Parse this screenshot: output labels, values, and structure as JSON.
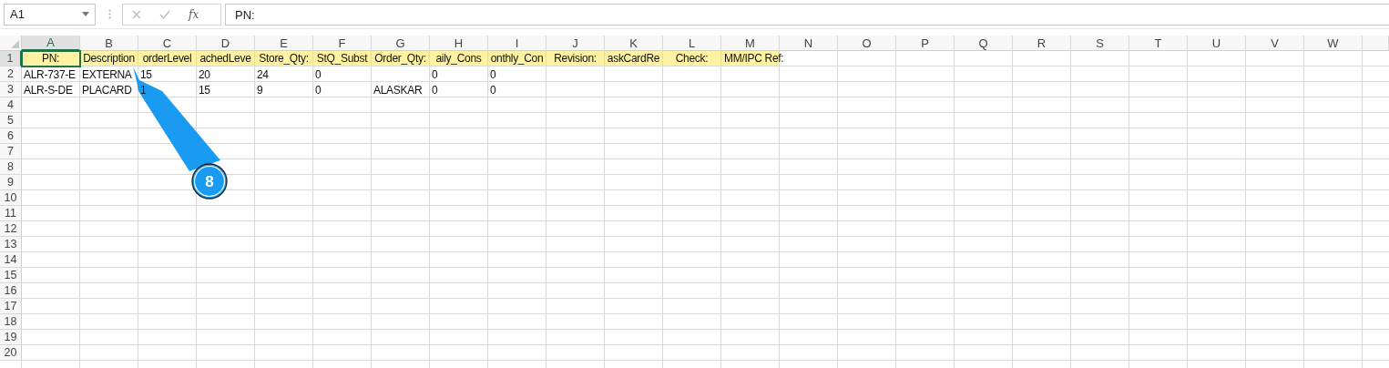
{
  "name_box": {
    "value": "A1"
  },
  "formula_bar": {
    "function_label": "fx",
    "value": "PN:"
  },
  "columns": [
    {
      "label": "A",
      "selected": true
    },
    {
      "label": "B",
      "selected": false
    },
    {
      "label": "C",
      "selected": false
    },
    {
      "label": "D",
      "selected": false
    },
    {
      "label": "E",
      "selected": false
    },
    {
      "label": "F",
      "selected": false
    },
    {
      "label": "G",
      "selected": false
    },
    {
      "label": "H",
      "selected": false
    },
    {
      "label": "I",
      "selected": false
    },
    {
      "label": "J",
      "selected": false
    },
    {
      "label": "K",
      "selected": false
    },
    {
      "label": "L",
      "selected": false
    },
    {
      "label": "M",
      "selected": false
    },
    {
      "label": "N",
      "selected": false
    },
    {
      "label": "O",
      "selected": false
    },
    {
      "label": "P",
      "selected": false
    },
    {
      "label": "Q",
      "selected": false
    },
    {
      "label": "R",
      "selected": false
    },
    {
      "label": "S",
      "selected": false
    },
    {
      "label": "T",
      "selected": false
    },
    {
      "label": "U",
      "selected": false
    },
    {
      "label": "V",
      "selected": false
    },
    {
      "label": "W",
      "selected": false
    }
  ],
  "rows": [
    {
      "number": "1",
      "selected": true,
      "color": "#fff2a3",
      "cells": [
        "PN:",
        "Description",
        "orderLevel",
        "achedLeve",
        "Store_Qty:",
        "StQ_Subst",
        "Order_Qty:",
        "aily_Cons",
        "onthly_Con",
        "Revision:",
        "askCardRe",
        "Check:",
        "MM/IPC Ref:"
      ]
    },
    {
      "number": "2",
      "selected": false,
      "cells": [
        "ALR-737-E",
        "EXTERNA",
        "15",
        "20",
        "24",
        "0",
        null,
        "0",
        "0"
      ]
    },
    {
      "number": "3",
      "selected": false,
      "cells": [
        "ALR-S-DE",
        "PLACARD",
        "1",
        "15",
        "9",
        "0",
        "ALASKAR",
        "0",
        "0"
      ]
    },
    {
      "number": "4",
      "selected": false
    },
    {
      "number": "5",
      "selected": false
    },
    {
      "number": "6",
      "selected": false
    },
    {
      "number": "7",
      "selected": false
    },
    {
      "number": "8",
      "selected": false
    },
    {
      "number": "9",
      "selected": false
    },
    {
      "number": "10",
      "selected": false
    },
    {
      "number": "11",
      "selected": false
    },
    {
      "number": "12",
      "selected": false
    },
    {
      "number": "13",
      "selected": false
    },
    {
      "number": "14",
      "selected": false
    },
    {
      "number": "15",
      "selected": false
    },
    {
      "number": "16",
      "selected": false
    },
    {
      "number": "17",
      "selected": false
    },
    {
      "number": "18",
      "selected": false
    },
    {
      "number": "19",
      "selected": false
    },
    {
      "number": "20",
      "selected": false
    }
  ],
  "callout": {
    "label": "8"
  }
}
